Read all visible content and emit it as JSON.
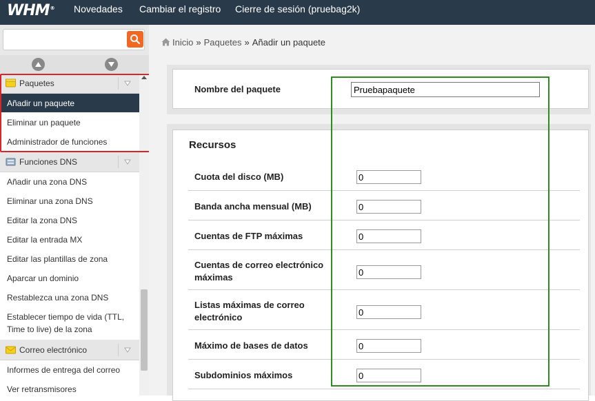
{
  "topbar": {
    "logo": "WHM",
    "logo_mark": "®",
    "nav": [
      "Novedades",
      "Cambiar el registro",
      "Cierre de sesión (pruebag2k)"
    ]
  },
  "sidebar": {
    "search": {
      "value": "",
      "placeholder": ""
    },
    "categories": [
      {
        "label": "Paquetes",
        "icon": "package-icon",
        "items": [
          "Añadir un paquete",
          "Eliminar un paquete",
          "Administrador de funciones"
        ],
        "active_index": 0
      },
      {
        "label": "Funciones DNS",
        "icon": "dns-icon",
        "items": [
          "Añadir una zona DNS",
          "Eliminar una zona DNS",
          "Editar la zona DNS",
          "Editar la entrada MX",
          "Editar las plantillas de zona",
          "Aparcar un dominio",
          "Restablezca una zona DNS",
          "Establecer tiempo de vida (TTL, Time to live) de la zona"
        ]
      },
      {
        "label": "Correo electrónico",
        "icon": "email-icon",
        "items": [
          "Informes de entrega del correo",
          "Ver retransmisores"
        ]
      }
    ]
  },
  "breadcrumb": {
    "home": "Inicio",
    "separator": "»",
    "parent": "Paquetes",
    "current": "Añadir un paquete"
  },
  "form": {
    "package_name_label": "Nombre del paquete",
    "package_name_value": "Pruebapaquete",
    "resources_title": "Recursos",
    "fields": [
      {
        "label": "Cuota del disco (MB)",
        "value": "0"
      },
      {
        "label": "Banda ancha mensual (MB)",
        "value": "0"
      },
      {
        "label": "Cuentas de FTP máximas",
        "value": "0"
      },
      {
        "label": "Cuentas de correo electrónico máximas",
        "value": "0"
      },
      {
        "label": "Listas máximas de correo electrónico",
        "value": "0"
      },
      {
        "label": "Máximo de bases de datos",
        "value": "0"
      },
      {
        "label": "Subdominios máximos",
        "value": "0"
      }
    ]
  },
  "colors": {
    "topbar": "#293a4a",
    "accent": "#f26722",
    "highlight_red": "#d9252a",
    "highlight_green": "#2e8b1f"
  }
}
